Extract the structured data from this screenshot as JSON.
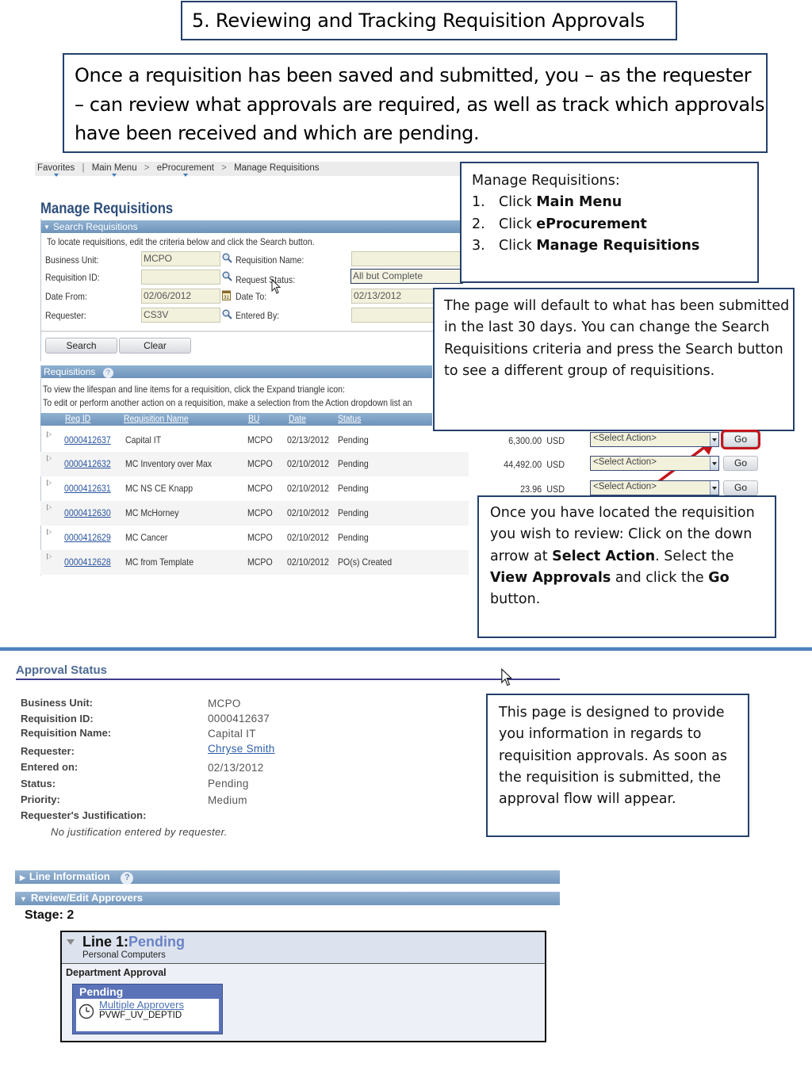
{
  "title": "5. Reviewing and Tracking Requisition Approvals",
  "intro": "Once a requisition has been saved and submitted, you – as the requester – can review what approvals are required, as well as track which approvals have been received and which are pending.",
  "callouts": {
    "manage": {
      "heading": "Manage Requisitions:",
      "steps": [
        {
          "num": "1.",
          "prefix": "Click ",
          "bold": "Main Menu"
        },
        {
          "num": "2.",
          "prefix": "Click ",
          "bold": "eProcurement"
        },
        {
          "num": "3.",
          "prefix": "Click ",
          "bold": "Manage Requisitions"
        }
      ]
    },
    "default_search": "The page will default to what has been submitted in the last 30 days.  You can change the Search Requisitions criteria and press the Search button to see a different group of requisitions.",
    "select_action": {
      "part1": "Once you have located the requisition you wish to review: Click on the down arrow at ",
      "bold1": "Select Action",
      "part2": ". Select the ",
      "bold2": "View Approvals",
      "part3": " and click the ",
      "bold3": "Go",
      "part4": " button."
    },
    "approval_page": "This page is designed to provide you information in regards to requisition approvals.  As soon as the requisition is submitted, the approval flow will appear."
  },
  "manage_requisitions": {
    "breadcrumb": [
      "Favorites",
      "Main Menu",
      "eProcurement",
      "Manage Requisitions"
    ],
    "page_title": "Manage Requisitions",
    "search_section": "Search Requisitions",
    "search_instructions": "To locate requisitions, edit the criteria below and click the Search button.",
    "fields": {
      "business_unit": {
        "label": "Business Unit:",
        "value": "MCPO"
      },
      "requisition_id": {
        "label": "Requisition ID:",
        "value": ""
      },
      "date_from": {
        "label": "Date From:",
        "value": "02/06/2012"
      },
      "requester": {
        "label": "Requester:",
        "value": "CS3V"
      },
      "requisition_name": {
        "label": "Requisition Name:",
        "value": ""
      },
      "request_status": {
        "label": "Request Status:",
        "value": "All but Complete"
      },
      "date_to": {
        "label": "Date To:",
        "value": "02/13/2012"
      },
      "entered_by": {
        "label": "Entered By:",
        "value": ""
      }
    },
    "buttons": {
      "search": "Search",
      "clear": "Clear"
    },
    "requisitions_section": "Requisitions",
    "grid_instructions": [
      "To view the lifespan and line items for a requisition, click the Expand triangle icon:",
      "To edit or perform another action on a requisition, make a selection from the Action dropdown list an"
    ],
    "columns": [
      "Req ID",
      "Requisition Name",
      "BU",
      "Date",
      "Status"
    ],
    "rows": [
      {
        "req_id": "0000412637",
        "name": "Capital IT",
        "bu": "MCPO",
        "date": "02/13/2012",
        "status": "Pending",
        "amount": "6,300.00",
        "currency": "USD",
        "action": "<Select Action>",
        "go": "Go"
      },
      {
        "req_id": "0000412632",
        "name": "MC Inventory over Max",
        "bu": "MCPO",
        "date": "02/10/2012",
        "status": "Pending",
        "amount": "44,492.00",
        "currency": "USD",
        "action": "<Select Action>",
        "go": "Go"
      },
      {
        "req_id": "0000412631",
        "name": "MC NS CE Knapp",
        "bu": "MCPO",
        "date": "02/10/2012",
        "status": "Pending",
        "amount": "23.96",
        "currency": "USD",
        "action": "<Select Action>",
        "go": "Go"
      },
      {
        "req_id": "0000412630",
        "name": "MC McHorney",
        "bu": "MCPO",
        "date": "02/10/2012",
        "status": "Pending"
      },
      {
        "req_id": "0000412629",
        "name": "MC Cancer",
        "bu": "MCPO",
        "date": "02/10/2012",
        "status": "Pending"
      },
      {
        "req_id": "0000412628",
        "name": "MC from Template",
        "bu": "MCPO",
        "date": "02/10/2012",
        "status": "PO(s) Created"
      }
    ],
    "highlight_color": "#c4161c"
  },
  "approval_status": {
    "title": "Approval Status",
    "fields": [
      {
        "label": "Business Unit:",
        "value": "MCPO"
      },
      {
        "label": "Requisition ID:",
        "value": "0000412637"
      },
      {
        "label": "Requisition Name:",
        "value": "Capital IT"
      },
      {
        "label": "Requester:",
        "value": "Chryse Smith"
      },
      {
        "label": "Entered on:",
        "value": "02/13/2012"
      },
      {
        "label": "Status:",
        "value": "Pending"
      },
      {
        "label": "Priority:",
        "value": "Medium"
      },
      {
        "label": "Requester's Justification:",
        "value": ""
      }
    ],
    "justification_note": "No justification entered by requester.",
    "line_information": "Line Information",
    "review_edit_approvers": "Review/Edit Approvers",
    "stage": "Stage: 2",
    "line": {
      "title": "Line 1:",
      "status": "Pending",
      "description": "Personal Computers",
      "path_name": "Department Approval",
      "step_status": "Pending",
      "approver_link": "Multiple Approvers",
      "approver_id": "PVWF_UV_DEPTID"
    }
  }
}
